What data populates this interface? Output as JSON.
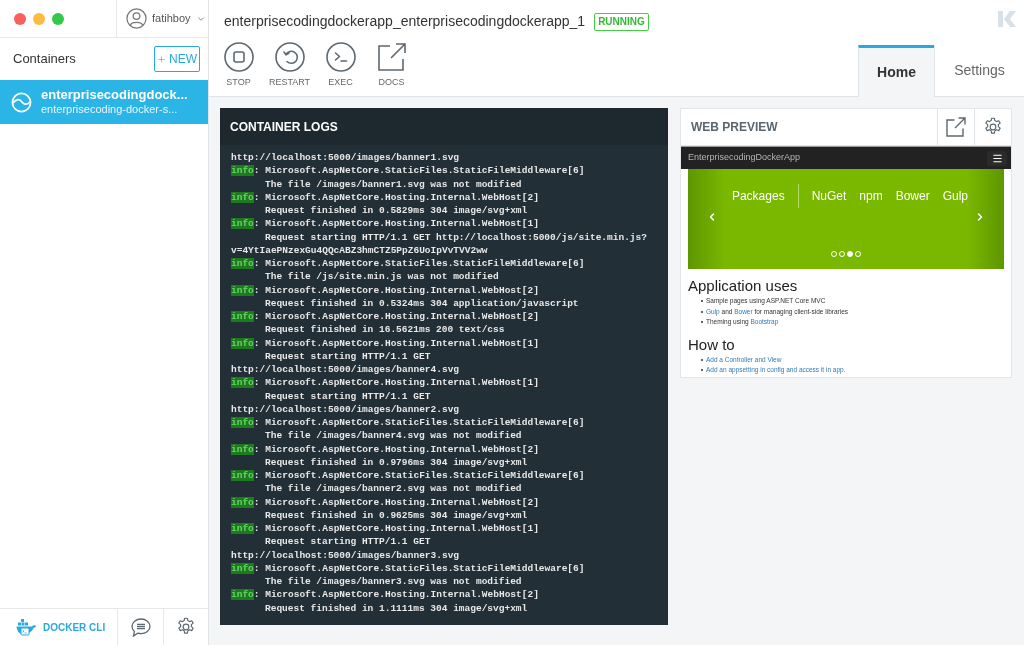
{
  "user": {
    "name": "fatihboy"
  },
  "sidebar": {
    "title": "Containers",
    "new_button": "NEW",
    "containers": [
      {
        "name": "enterprisecodingdock...",
        "image": "enterprisecoding-docker-s...",
        "selected": true
      }
    ],
    "footer": {
      "docker_cli": "DOCKER CLI"
    }
  },
  "container": {
    "title": "enterprisecodingdockerapp_enterprisecodingdockerapp_1",
    "status": {
      "label": "RUNNING",
      "kind": "running"
    },
    "actions": [
      {
        "label": "STOP",
        "kind": "stop"
      },
      {
        "label": "RESTART",
        "kind": "restart"
      },
      {
        "label": "EXEC",
        "kind": "exec"
      },
      {
        "label": "DOCS",
        "kind": "docs"
      }
    ],
    "tabs": [
      {
        "label": "Home",
        "selected": true
      },
      {
        "label": "Settings",
        "selected": false
      }
    ]
  },
  "logs": {
    "title": "CONTAINER LOGS",
    "lines": [
      {
        "kind": "wrap",
        "text": "http://localhost:5000/images/banner1.svg"
      },
      {
        "kind": "entry",
        "level": "info",
        "text": ": Microsoft.AspNetCore.StaticFiles.StaticFileMiddleware[6]"
      },
      {
        "kind": "message",
        "text": "The file /images/banner1.svg was not modified"
      },
      {
        "kind": "entry",
        "level": "info",
        "text": ": Microsoft.AspNetCore.Hosting.Internal.WebHost[2]"
      },
      {
        "kind": "message",
        "text": "Request finished in 0.5829ms 304 image/svg+xml"
      },
      {
        "kind": "entry",
        "level": "info",
        "text": ": Microsoft.AspNetCore.Hosting.Internal.WebHost[1]"
      },
      {
        "kind": "message",
        "text": "Request starting HTTP/1.1 GET http://localhost:5000/js/site.min.js?"
      },
      {
        "kind": "wrap",
        "text": "v=4YtIaePNzexGu4QQcABZ3hmCTZ5PpZ6UoIpVvTVV2ww"
      },
      {
        "kind": "entry",
        "level": "info",
        "text": ": Microsoft.AspNetCore.StaticFiles.StaticFileMiddleware[6]"
      },
      {
        "kind": "message",
        "text": "The file /js/site.min.js was not modified"
      },
      {
        "kind": "entry",
        "level": "info",
        "text": ": Microsoft.AspNetCore.Hosting.Internal.WebHost[2]"
      },
      {
        "kind": "message",
        "text": "Request finished in 0.5324ms 304 application/javascript"
      },
      {
        "kind": "entry",
        "level": "info",
        "text": ": Microsoft.AspNetCore.Hosting.Internal.WebHost[2]"
      },
      {
        "kind": "message",
        "text": "Request finished in 16.5621ms 200 text/css"
      },
      {
        "kind": "entry",
        "level": "info",
        "text": ": Microsoft.AspNetCore.Hosting.Internal.WebHost[1]"
      },
      {
        "kind": "message",
        "text": "Request starting HTTP/1.1 GET"
      },
      {
        "kind": "wrap",
        "text": "http://localhost:5000/images/banner4.svg"
      },
      {
        "kind": "entry",
        "level": "info",
        "text": ": Microsoft.AspNetCore.Hosting.Internal.WebHost[1]"
      },
      {
        "kind": "message",
        "text": "Request starting HTTP/1.1 GET"
      },
      {
        "kind": "wrap",
        "text": "http://localhost:5000/images/banner2.svg"
      },
      {
        "kind": "entry",
        "level": "info",
        "text": ": Microsoft.AspNetCore.StaticFiles.StaticFileMiddleware[6]"
      },
      {
        "kind": "message",
        "text": "The file /images/banner4.svg was not modified"
      },
      {
        "kind": "entry",
        "level": "info",
        "text": ": Microsoft.AspNetCore.Hosting.Internal.WebHost[2]"
      },
      {
        "kind": "message",
        "text": "Request finished in 0.9796ms 304 image/svg+xml"
      },
      {
        "kind": "entry",
        "level": "info",
        "text": ": Microsoft.AspNetCore.StaticFiles.StaticFileMiddleware[6]"
      },
      {
        "kind": "message",
        "text": "The file /images/banner2.svg was not modified"
      },
      {
        "kind": "entry",
        "level": "info",
        "text": ": Microsoft.AspNetCore.Hosting.Internal.WebHost[2]"
      },
      {
        "kind": "message",
        "text": "Request finished in 0.9625ms 304 image/svg+xml"
      },
      {
        "kind": "entry",
        "level": "info",
        "text": ": Microsoft.AspNetCore.Hosting.Internal.WebHost[1]"
      },
      {
        "kind": "message",
        "text": "Request starting HTTP/1.1 GET"
      },
      {
        "kind": "wrap",
        "text": "http://localhost:5000/images/banner3.svg"
      },
      {
        "kind": "entry",
        "level": "info",
        "text": ": Microsoft.AspNetCore.StaticFiles.StaticFileMiddleware[6]"
      },
      {
        "kind": "message",
        "text": "The file /images/banner3.svg was not modified"
      },
      {
        "kind": "entry",
        "level": "info",
        "text": ": Microsoft.AspNetCore.Hosting.Internal.WebHost[2]"
      },
      {
        "kind": "message",
        "text": "Request finished in 1.1111ms 304 image/svg+xml"
      }
    ]
  },
  "web_preview": {
    "title": "WEB PREVIEW",
    "site": {
      "brand": "EnterprisecodingDockerApp",
      "carousel": {
        "heading": "Packages",
        "items": [
          "NuGet",
          "npm",
          "Bower",
          "Gulp"
        ],
        "dots": [
          {
            "selected": false
          },
          {
            "selected": false
          },
          {
            "selected": true
          },
          {
            "selected": false
          }
        ]
      },
      "sections": [
        {
          "heading": "Application uses",
          "items": [
            {
              "parts": [
                {
                  "text": "Sample pages using ASP.NET Core MVC",
                  "link": false
                }
              ]
            },
            {
              "parts": [
                {
                  "text": "Gulp",
                  "link": true
                },
                {
                  "text": " and ",
                  "link": false
                },
                {
                  "text": "Bower",
                  "link": true
                },
                {
                  "text": " for managing client-side libraries",
                  "link": false
                }
              ]
            },
            {
              "parts": [
                {
                  "text": "Theming using ",
                  "link": false
                },
                {
                  "text": "Bootstrap",
                  "link": true
                }
              ]
            }
          ]
        },
        {
          "heading": "How to",
          "items": [
            {
              "parts": [
                {
                  "text": "Add a Controller and View",
                  "link": true
                }
              ]
            },
            {
              "parts": [
                {
                  "text": "Add an appsetting in config and access it in app.",
                  "link": true
                }
              ]
            }
          ]
        }
      ]
    }
  }
}
